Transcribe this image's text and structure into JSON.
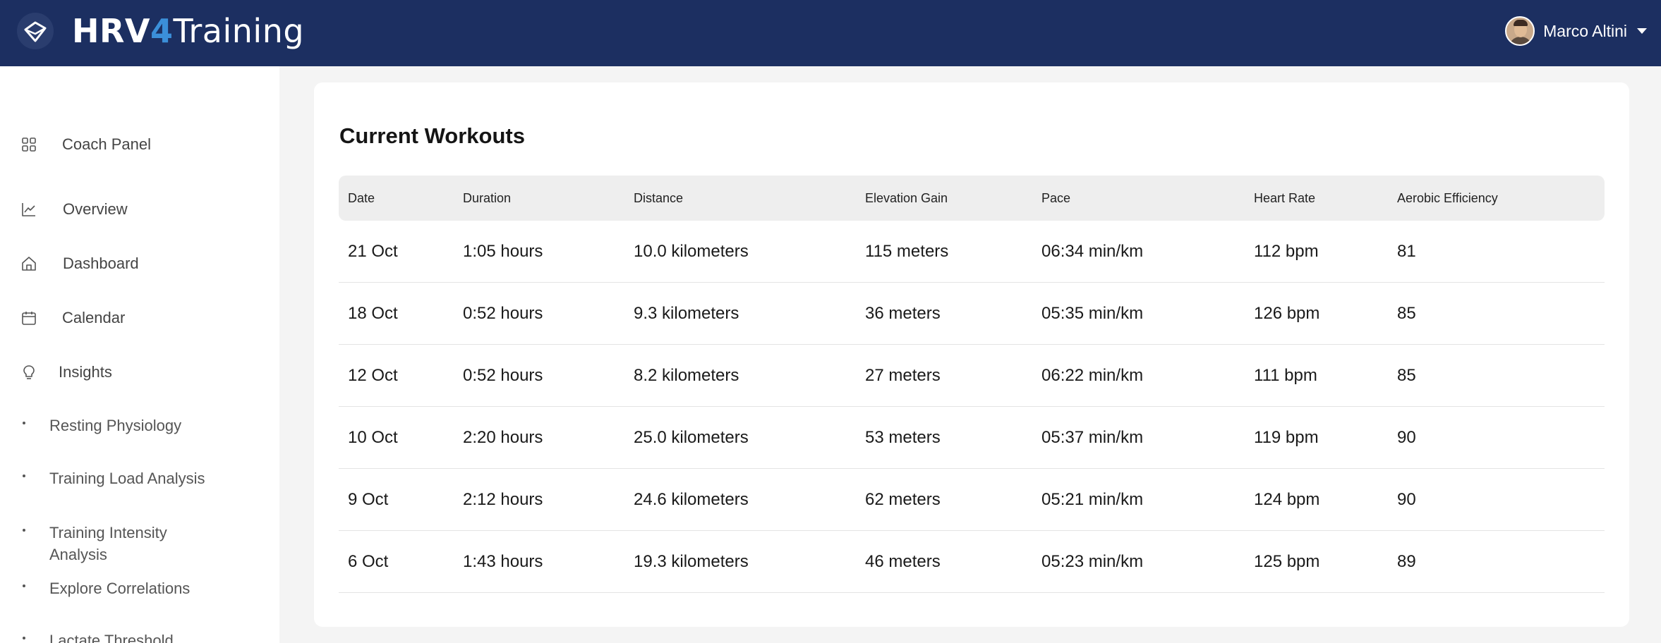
{
  "header": {
    "brand_part1": "HRV",
    "brand_part2": "4",
    "brand_part3": "Training",
    "user_name": "Marco Altini",
    "brand_color": "#1c2f61",
    "accent_color": "#3b8fd9"
  },
  "sidebar": {
    "items": [
      {
        "label": "Coach Panel",
        "icon": "grid-icon"
      },
      {
        "label": "Overview",
        "icon": "line-chart-icon"
      },
      {
        "label": "Dashboard",
        "icon": "home-icon"
      },
      {
        "label": "Calendar",
        "icon": "calendar-icon"
      },
      {
        "label": "Insights",
        "icon": "lightbulb-icon"
      }
    ],
    "subitems": [
      {
        "label": "Resting Physiology"
      },
      {
        "label": "Training Load Analysis"
      },
      {
        "label": "Training Intensity Analysis"
      },
      {
        "label": "Explore Correlations"
      },
      {
        "label": "Lactate Threshold"
      }
    ]
  },
  "main": {
    "title": "Current Workouts",
    "columns": [
      "Date",
      "Duration",
      "Distance",
      "Elevation Gain",
      "Pace",
      "Heart Rate",
      "Aerobic Efficiency"
    ],
    "rows": [
      [
        "21 Oct",
        "1:05 hours",
        "10.0 kilometers",
        "115 meters",
        "06:34 min/km",
        "112 bpm",
        "81"
      ],
      [
        "18 Oct",
        "0:52 hours",
        "9.3 kilometers",
        "36 meters",
        "05:35 min/km",
        "126 bpm",
        "85"
      ],
      [
        "12 Oct",
        "0:52 hours",
        "8.2 kilometers",
        "27 meters",
        "06:22 min/km",
        "111 bpm",
        "85"
      ],
      [
        "10 Oct",
        "2:20 hours",
        "25.0 kilometers",
        "53 meters",
        "05:37 min/km",
        "119 bpm",
        "90"
      ],
      [
        "9 Oct",
        "2:12 hours",
        "24.6 kilometers",
        "62 meters",
        "05:21 min/km",
        "124 bpm",
        "90"
      ],
      [
        "6 Oct",
        "1:43 hours",
        "19.3 kilometers",
        "46 meters",
        "05:23 min/km",
        "125 bpm",
        "89"
      ]
    ]
  }
}
